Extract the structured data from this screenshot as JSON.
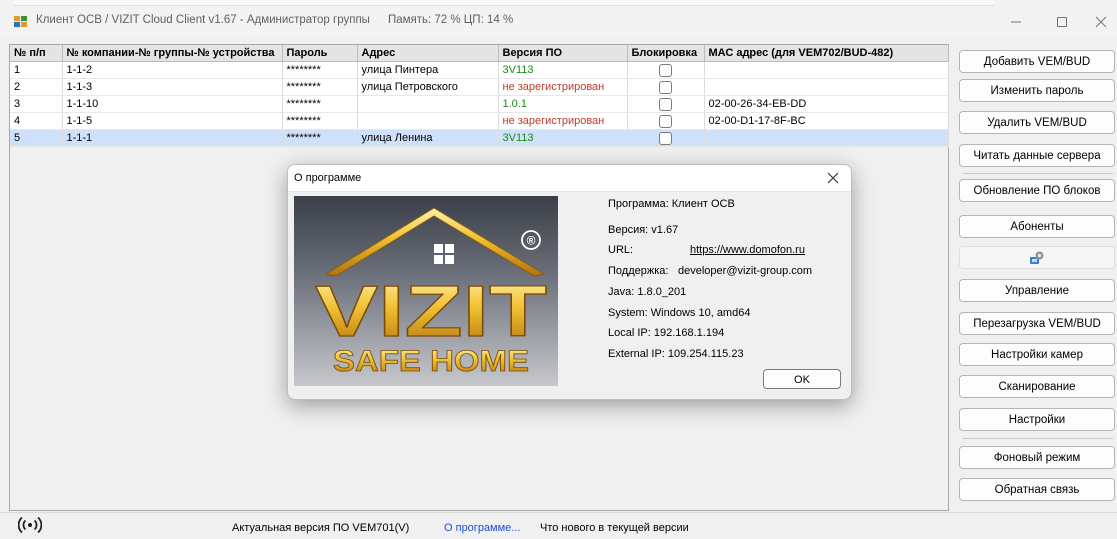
{
  "window": {
    "title": "Клиент ОСВ / VIZIT Cloud Client v1.67 - Администратор группы",
    "memory": "Память: 72 %",
    "cpu": "ЦП: 14 %",
    "minimize_icon": "minimize-icon",
    "maximize_icon": "maximize-icon",
    "close_icon": "close-icon"
  },
  "table": {
    "columns": [
      "№ п/п",
      "№ компании-№ группы-№ устройства",
      "Пароль",
      "Адрес",
      "Версия ПО",
      "Блокировка",
      "МАС адрес (для VEM702/BUD-482)"
    ],
    "rows": [
      {
        "num": "1",
        "id": "1-1-2",
        "password": "********",
        "address": "улица Пинтера",
        "version": "3V113",
        "version_color": "#1a8a1a",
        "mac": ""
      },
      {
        "num": "2",
        "id": "1-1-3",
        "password": "********",
        "address": "улица Петровского",
        "version": "не зарегистрирован",
        "version_color": "#c0392b",
        "mac": ""
      },
      {
        "num": "3",
        "id": "1-1-10",
        "password": "********",
        "address": "",
        "version": "1.0.1",
        "version_color": "#1a8a1a",
        "mac": "02-00-26-34-EB-DD"
      },
      {
        "num": "4",
        "id": "1-1-5",
        "password": "********",
        "address": "",
        "version": "не зарегистрирован",
        "version_color": "#c0392b",
        "mac": "02-00-D1-17-8F-BC"
      },
      {
        "num": "5",
        "id": "1-1-1",
        "password": "********",
        "address": "улица Ленина",
        "version": "3V113",
        "version_color": "#1a8a1a",
        "mac": ""
      }
    ],
    "selected_row": 5
  },
  "sidebar": {
    "add": "Добавить VEM/BUD",
    "change_password": "Изменить пароль",
    "delete": "Удалить VEM/BUD",
    "read_server": "Читать данные сервера",
    "firmware_update": "Обновление ПО блоков",
    "subscribers": "Абоненты",
    "network_icon": "network-settings-icon",
    "control": "Управление",
    "reboot": "Перезагрузка VEM/BUD",
    "camera_settings": "Настройки камер",
    "scanning": "Сканирование",
    "settings": "Настройки",
    "background_mode": "Фоновый режим",
    "feedback": "Обратная связь"
  },
  "statusbar": {
    "signal_icon": "signal-icon",
    "actual_version": "Актуальная версия ПО VEM701(V)",
    "about_link": "О программе...",
    "whats_new": "Что нового в текущей версии"
  },
  "about_dialog": {
    "title": "О программе",
    "logo_text_top": "VIZIT",
    "logo_text_bottom": "SAFE HOME",
    "registered_mark": "®",
    "program": "Программа: Клиент ОСВ",
    "version": "Версия: v1.67",
    "url_label": "URL:",
    "url_value": "https://www.domofon.ru",
    "support_label": "Поддержка:",
    "support_value": "developer@vizit-group.com",
    "java": "Java: 1.8.0_201",
    "system": "System: Windows 10, amd64",
    "local_ip": "Local IP: 192.168.1.194",
    "external_ip": "External IP: 109.254.115.23",
    "ok": "OK",
    "accent": "#e8b020"
  }
}
